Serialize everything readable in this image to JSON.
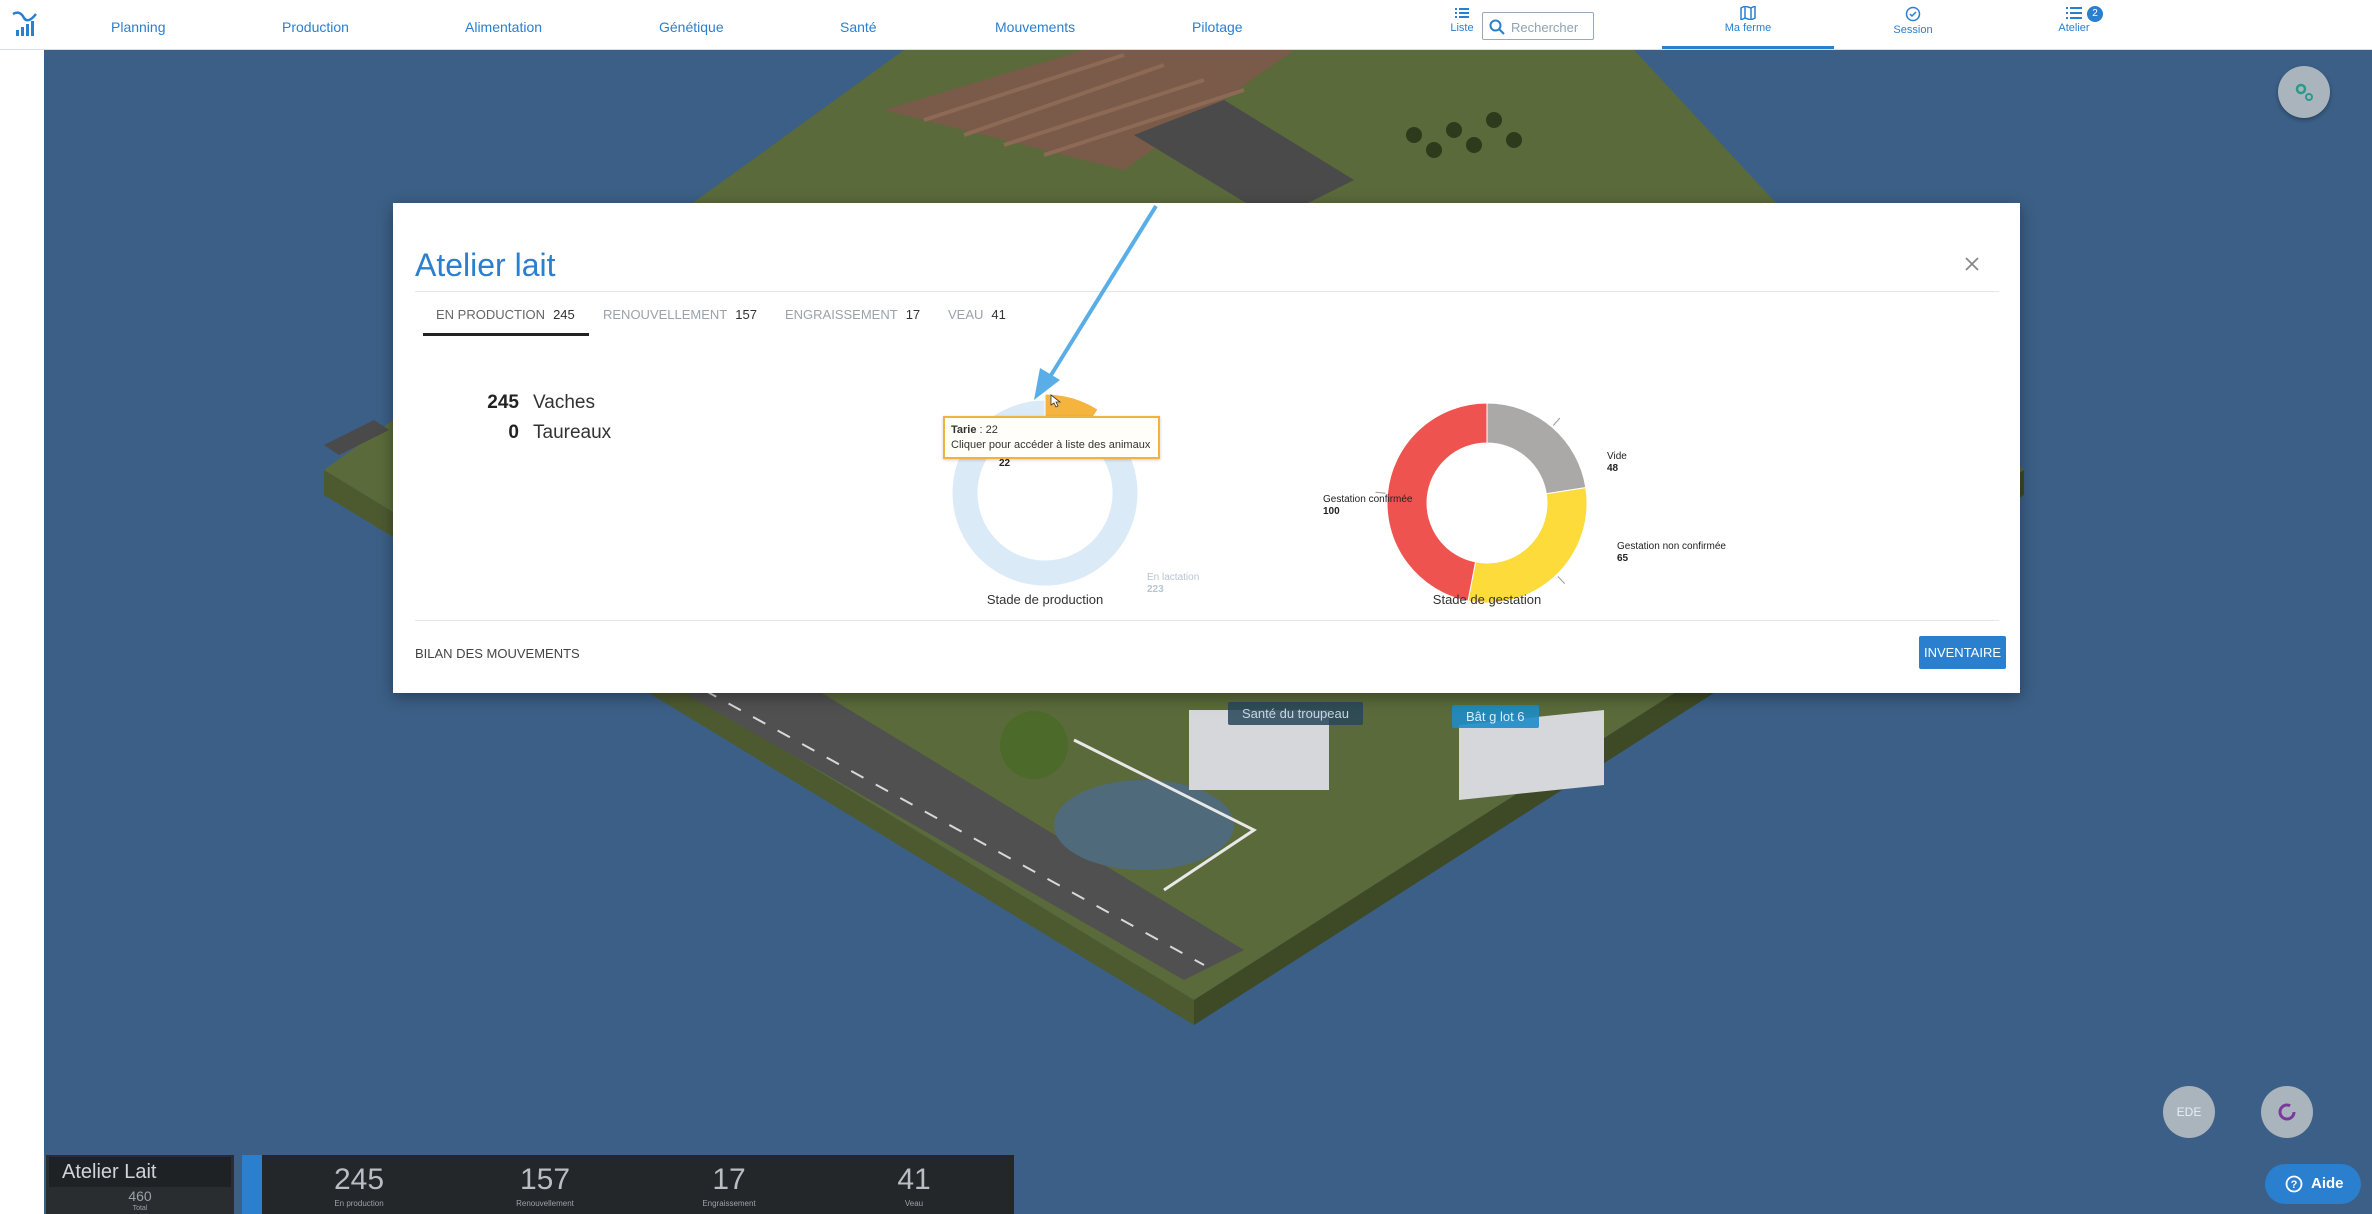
{
  "nav": {
    "items": [
      {
        "label": "Planning"
      },
      {
        "label": "Production"
      },
      {
        "label": "Alimentation"
      },
      {
        "label": "Génétique"
      },
      {
        "label": "Santé"
      },
      {
        "label": "Mouvements"
      },
      {
        "label": "Pilotage"
      }
    ],
    "liste_label": "Liste",
    "search_placeholder": "Rechercher",
    "ma_ferme_label": "Ma ferme",
    "session_label": "Session",
    "atelier_label": "Atelier",
    "atelier_badge": "2"
  },
  "scene": {
    "label_sante": "Santé du troupeau",
    "label_bat": "Bât g lot 6",
    "ede_label": "EDE",
    "accent_color": "#2a7fce"
  },
  "modal": {
    "title": "Atelier lait",
    "tabs": [
      {
        "label": "EN PRODUCTION",
        "count": "245"
      },
      {
        "label": "RENOUVELLEMENT",
        "count": "157"
      },
      {
        "label": "ENGRAISSEMENT",
        "count": "17"
      },
      {
        "label": "VEAU",
        "count": "41"
      }
    ],
    "counts": [
      {
        "value": "245",
        "label": "Vaches"
      },
      {
        "value": "0",
        "label": "Taureaux"
      }
    ],
    "tooltip": {
      "name": "Tarie",
      "value": ": 22",
      "hint": "Cliquer pour accéder à liste des animaux"
    },
    "bilan_label": "BILAN DES MOUVEMENTS",
    "inventaire_label": "INVENTAIRE"
  },
  "chart_data": [
    {
      "type": "pie",
      "title": "Stade de production",
      "labels": [
        "Tarie",
        "En lactation"
      ],
      "values": [
        22,
        223
      ],
      "colors": [
        "#f4b43e",
        "#dbeaf7"
      ]
    },
    {
      "type": "pie",
      "title": "Stade de gestation",
      "labels": [
        "Vide",
        "Gestation non confirmée",
        "Gestation confirmée"
      ],
      "values": [
        48,
        65,
        100
      ],
      "colors": [
        "#aba8a8",
        "#fcdb3a",
        "#ef5350"
      ]
    }
  ],
  "bottom": {
    "title": "Atelier Lait",
    "total": "460",
    "total_label": "Total",
    "stats": [
      {
        "value": "245",
        "label": "En production"
      },
      {
        "value": "157",
        "label": "Renouvellement"
      },
      {
        "value": "17",
        "label": "Engraissement"
      },
      {
        "value": "41",
        "label": "Veau"
      }
    ],
    "aide_label": "Aide"
  }
}
